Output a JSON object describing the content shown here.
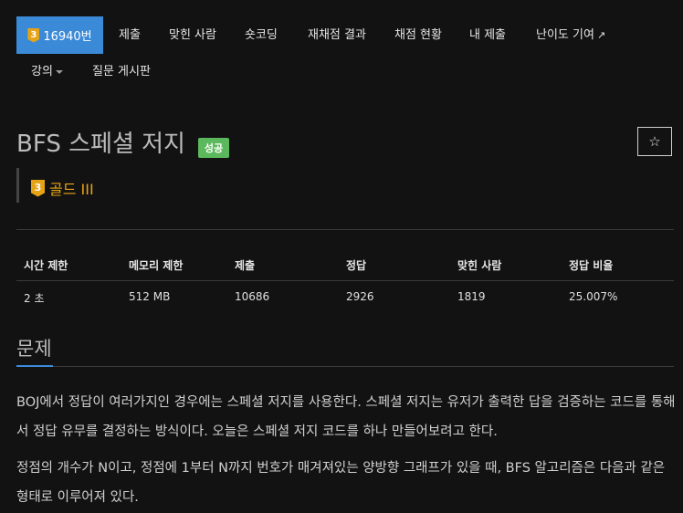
{
  "nav": {
    "problem_number": "16940번",
    "tier_digit": "3",
    "items": [
      "제출",
      "맞힌 사람",
      "숏코딩",
      "재채점 결과",
      "채점 현황",
      "내 제출",
      "난이도 기여"
    ],
    "row2": [
      "강의",
      "질문 게시판"
    ]
  },
  "problem": {
    "title": "BFS 스페셜 저지",
    "status_badge": "성공",
    "star": "☆",
    "tier_digit": "3",
    "tier_label": "골드 III"
  },
  "info_table": {
    "headers": [
      "시간 제한",
      "메모리 제한",
      "제출",
      "정답",
      "맞힌 사람",
      "정답 비율"
    ],
    "values": [
      "2 초",
      "512 MB",
      "10686",
      "2926",
      "1819",
      "25.007%"
    ]
  },
  "section": {
    "title": "문제",
    "paragraphs": [
      "BOJ에서 정답이 여러가지인 경우에는 스페셜 저지를 사용한다. 스페셜 저지는 유저가 출력한 답을 검증하는 코드를 통해서 정답 유무를 결정하는 방식이다. 오늘은 스페셜 저지 코드를 하나 만들어보려고 한다.",
      "정점의 개수가 N이고, 정점에 1부터 N까지 번호가 매겨져있는 양방향 그래프가 있을 때, BFS 알고리즘은 다음과 같은 형태로 이루어져 있다."
    ]
  },
  "colors": {
    "accent": "#3b8ad8",
    "gold": "#e6a316",
    "success": "#5cb85c",
    "bg": "#121212"
  }
}
